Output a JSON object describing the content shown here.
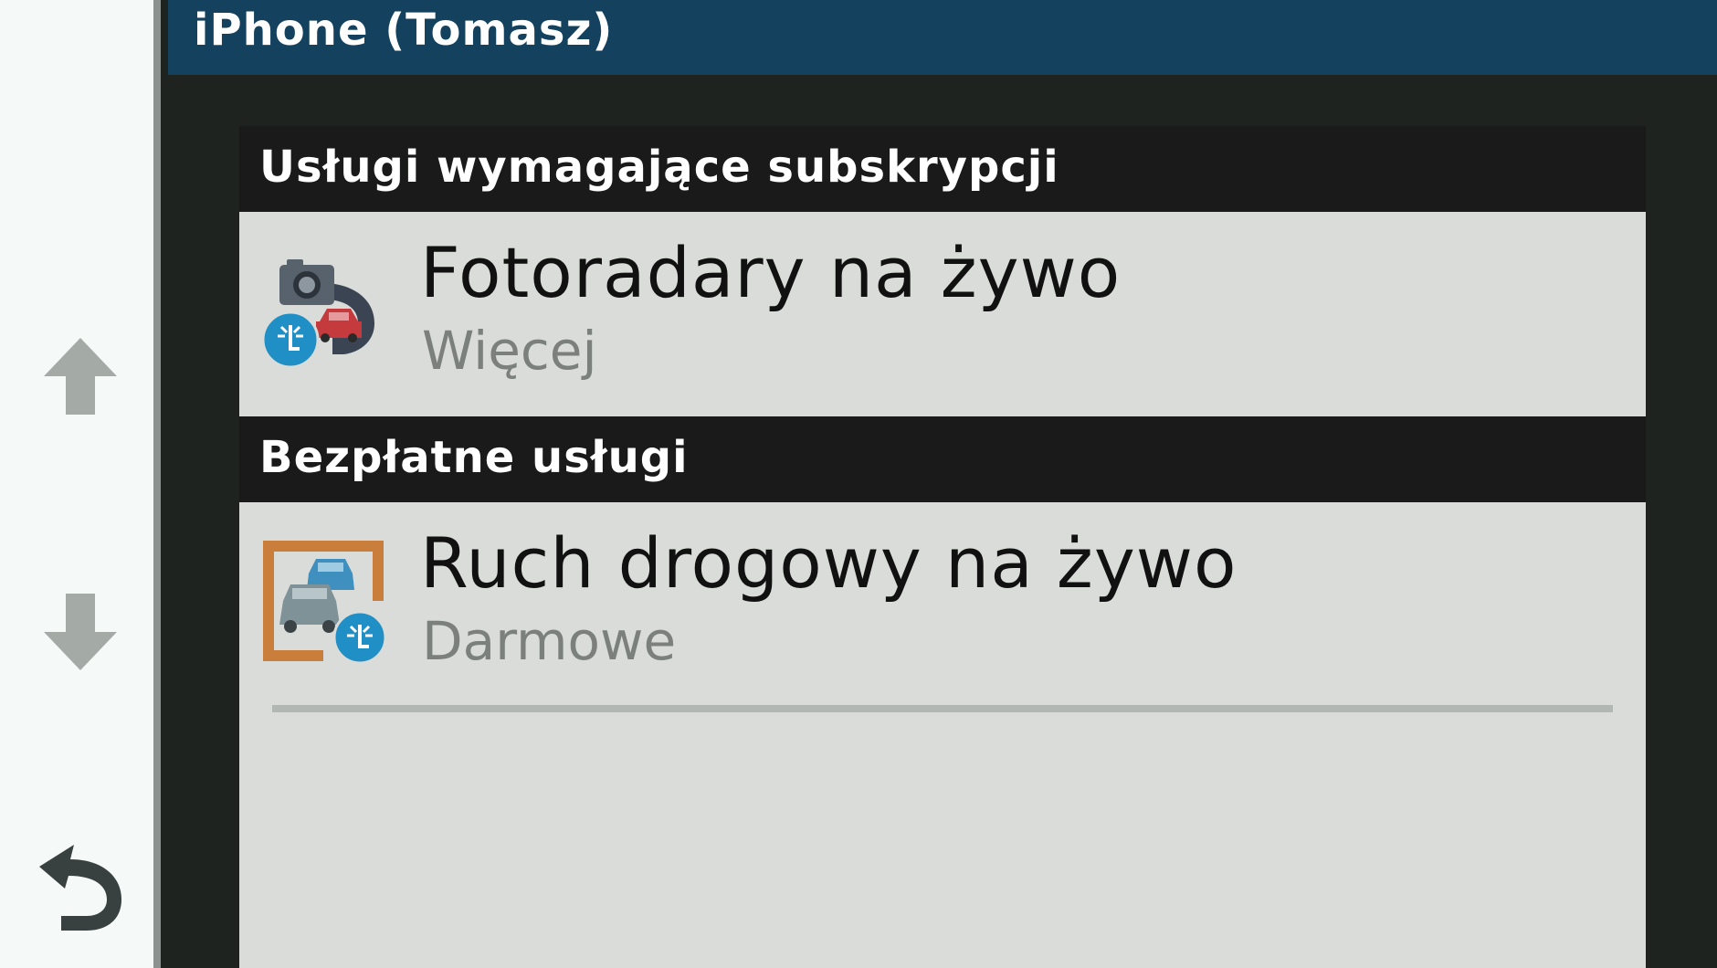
{
  "header": {
    "title": "iPhone (Tomasz)"
  },
  "nav": {
    "up_icon": "arrow-up-icon",
    "down_icon": "arrow-down-icon",
    "back_icon": "back-icon"
  },
  "sections": [
    {
      "header": "Usługi wymagające subskrypcji",
      "items": [
        {
          "title": "Fotoradary na żywo",
          "subtitle": "Więcej",
          "icon": "live-speed-camera-icon"
        }
      ]
    },
    {
      "header": "Bezpłatne usługi",
      "items": [
        {
          "title": "Ruch drogowy na żywo",
          "subtitle": "Darmowe",
          "icon": "live-traffic-icon"
        }
      ]
    }
  ],
  "colors": {
    "title_bar": "#14415e",
    "section_header": "#191a19",
    "list_background": "#d9dcd8",
    "badge_blue": "#1f8fc6",
    "car_red": "#c43a3d",
    "frame_orange": "#c97f3b"
  }
}
